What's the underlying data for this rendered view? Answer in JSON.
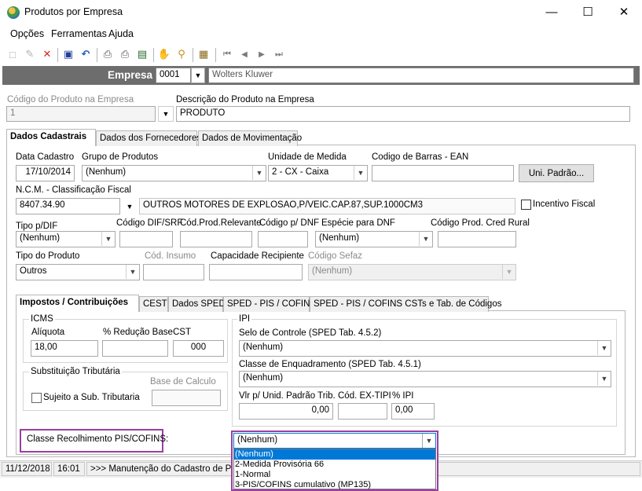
{
  "window": {
    "title": "Produtos por Empresa",
    "minimize": "—",
    "maximize": "☐",
    "close": "✕"
  },
  "menu": [
    {
      "label": "Opções"
    },
    {
      "label": "Ferramentas"
    },
    {
      "label": "Ajuda"
    }
  ],
  "toolbar": {
    "icons": [
      "new-icon",
      "edit-icon",
      "delete-icon",
      "save-icon",
      "undo-icon",
      "print-icon",
      "print-preview-icon",
      "export-icon",
      "hand-icon",
      "search-icon",
      "properties-icon",
      "first-record-icon",
      "prev-record-icon",
      "next-record-icon",
      "last-record-icon"
    ],
    "glyphs": [
      "□",
      "✎",
      "✕",
      "▣",
      "↶",
      "⎙",
      "⎙",
      "▤",
      "✋",
      "⚲",
      "▦",
      "⏮",
      "◀",
      "▶",
      "⏭"
    ]
  },
  "empresa": {
    "label": "Empresa",
    "code": "0001",
    "name": "Wolters Kluwer"
  },
  "product": {
    "code_label": "Código do Produto na Empresa",
    "code_value": "1",
    "desc_label": "Descrição do Produto na Empresa",
    "desc_value": "PRODUTO"
  },
  "main_tabs": [
    {
      "label": "Dados Cadastrais"
    },
    {
      "label": "Dados dos Fornecedores"
    },
    {
      "label": "Dados de Movimentação"
    }
  ],
  "dados": {
    "data_cadastro_label": "Data Cadastro",
    "data_cadastro": "17/10/2014",
    "grupo_label": "Grupo de Produtos",
    "grupo": "(Nenhum)",
    "unidade_label": "Unidade de Medida",
    "unidade": "2 - CX - Caixa",
    "ean_label": "Codigo de Barras - EAN",
    "ean": "",
    "uni_padrao_btn": "Uni. Padrão...",
    "ncm_label": "N.C.M. -  Classificação Fiscal",
    "ncm": "8407.34.90",
    "ncm_desc": "OUTROS MOTORES DE EXPLOSAO,P/VEIC.CAP.87,SUP.1000CM3",
    "incentivo_label": "Incentivo Fiscal",
    "tipo_dif_label": "Tipo p/DIF",
    "tipo_dif": "(Nenhum)",
    "cod_dif_label": "Código DIF/SRF",
    "cod_prod_rel_label": "Cód.Prod.Relevante",
    "cod_dnf_label": "Código p/ DNF",
    "especie_dnf_label": "Espécie para DNF",
    "especie_dnf": "(Nenhum)",
    "cod_cred_rural_label": "Código Prod. Cred Rural",
    "tipo_produto_label": "Tipo do Produto",
    "tipo_produto": "Outros",
    "cod_insumo_label": "Cód. Insumo",
    "capacidade_label": "Capacidade Recipiente",
    "cod_sefaz_label": "Código Sefaz",
    "cod_sefaz": "(Nenhum)"
  },
  "sub_tabs": [
    {
      "label": "Impostos / Contribuições"
    },
    {
      "label": "CEST"
    },
    {
      "label": "Dados SPED"
    },
    {
      "label": "SPED - PIS / COFINS"
    },
    {
      "label": "SPED - PIS / COFINS CSTs e Tab. de Códigos"
    }
  ],
  "icms": {
    "title": "ICMS",
    "aliquota_label": "Alíquota",
    "aliquota": "18,00",
    "reducao_label": "% Redução Base",
    "reducao": "",
    "cst_label": "CST",
    "cst": "000"
  },
  "subst": {
    "title": "Substituição Tributária",
    "sujeito_label": "Sujeito a Sub. Tributaria",
    "base_label": "Base de Calculo",
    "base": ""
  },
  "ipi": {
    "title": "IPI",
    "selo_label": "Selo de Controle (SPED Tab. 4.5.2)",
    "selo": "(Nenhum)",
    "classe_label": "Classe de Enquadramento (SPED Tab. 4.5.1)",
    "classe": "(Nenhum)",
    "vlr_label": "Vlr p/ Unid. Padrão Trib.",
    "vlr": "0,00",
    "cod_ex_label": "Cód. EX-TIPI",
    "cod_ex": "",
    "pct_label": "% IPI",
    "pct": "0,00"
  },
  "pis_cofins": {
    "label": "Classe Recolhimento PIS/COFINS:",
    "selected": "(Nenhum)",
    "options": [
      "(Nenhum)",
      "2-Medida Provisória 66",
      "1-Normal",
      "3-PIS/COFINS cumulativo (MP135)"
    ]
  },
  "status": {
    "date": "11/12/2018",
    "time": "16:01",
    "message": ">>> Manutenção do Cadastro de Produtos"
  },
  "colors": {
    "highlight": "#9b3fa0",
    "selection": "#0078d7",
    "empresa_bar": "#6d6d6d"
  }
}
